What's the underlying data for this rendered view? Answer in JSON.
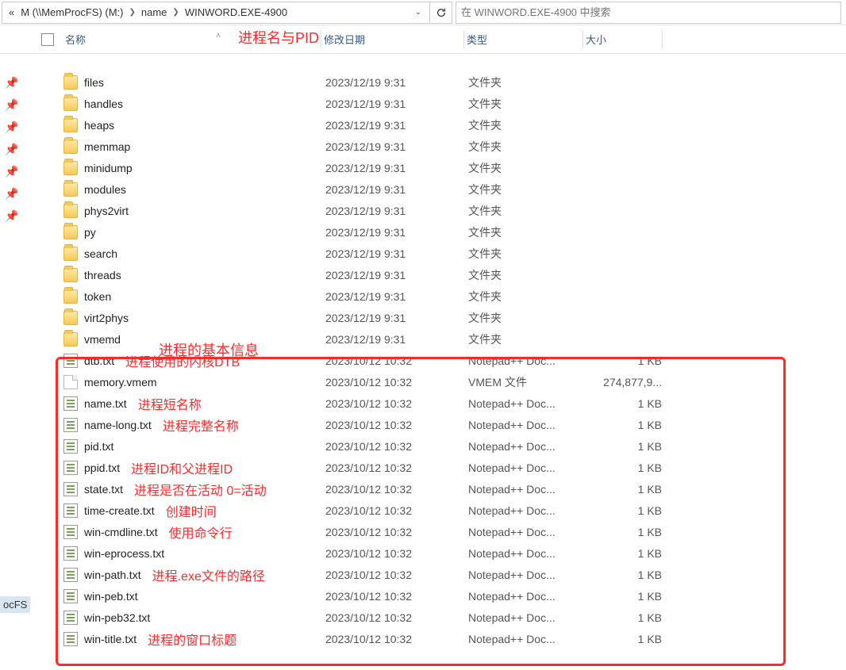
{
  "breadcrumb": {
    "prefix": "«",
    "parts": [
      "M (\\\\MemProcFS) (M:)",
      "name",
      "WINWORD.EXE-4900"
    ]
  },
  "search": {
    "placeholder": "在 WINWORD.EXE-4900 中搜索"
  },
  "columns": {
    "name": "名称",
    "date": "修改日期",
    "type": "类型",
    "size": "大小"
  },
  "annot_top": "进程名与PID",
  "annot_mid": "进程的基本信息",
  "ocfs_label": "ocFS",
  "rows": [
    {
      "icon": "folder",
      "name": "files",
      "date": "2023/12/19 9:31",
      "type": "文件夹",
      "size": ""
    },
    {
      "icon": "folder",
      "name": "handles",
      "date": "2023/12/19 9:31",
      "type": "文件夹",
      "size": ""
    },
    {
      "icon": "folder",
      "name": "heaps",
      "date": "2023/12/19 9:31",
      "type": "文件夹",
      "size": ""
    },
    {
      "icon": "folder",
      "name": "memmap",
      "date": "2023/12/19 9:31",
      "type": "文件夹",
      "size": ""
    },
    {
      "icon": "folder",
      "name": "minidump",
      "date": "2023/12/19 9:31",
      "type": "文件夹",
      "size": ""
    },
    {
      "icon": "folder",
      "name": "modules",
      "date": "2023/12/19 9:31",
      "type": "文件夹",
      "size": ""
    },
    {
      "icon": "folder",
      "name": "phys2virt",
      "date": "2023/12/19 9:31",
      "type": "文件夹",
      "size": ""
    },
    {
      "icon": "folder",
      "name": "py",
      "date": "2023/12/19 9:31",
      "type": "文件夹",
      "size": ""
    },
    {
      "icon": "folder",
      "name": "search",
      "date": "2023/12/19 9:31",
      "type": "文件夹",
      "size": ""
    },
    {
      "icon": "folder",
      "name": "threads",
      "date": "2023/12/19 9:31",
      "type": "文件夹",
      "size": ""
    },
    {
      "icon": "folder",
      "name": "token",
      "date": "2023/12/19 9:31",
      "type": "文件夹",
      "size": ""
    },
    {
      "icon": "folder",
      "name": "virt2phys",
      "date": "2023/12/19 9:31",
      "type": "文件夹",
      "size": ""
    },
    {
      "icon": "folder",
      "name": "vmemd",
      "date": "2023/12/19 9:31",
      "type": "文件夹",
      "size": ""
    },
    {
      "icon": "txt",
      "name": "dtb.txt",
      "annot": "进程使用的内核DTB",
      "date": "2023/10/12 10:32",
      "type": "Notepad++ Doc...",
      "size": "1 KB"
    },
    {
      "icon": "file",
      "name": "memory.vmem",
      "annot": "",
      "date": "2023/10/12 10:32",
      "type": "VMEM 文件",
      "size": "274,877,9..."
    },
    {
      "icon": "txt",
      "name": "name.txt",
      "annot": "进程短名称",
      "date": "2023/10/12 10:32",
      "type": "Notepad++ Doc...",
      "size": "1 KB"
    },
    {
      "icon": "txt",
      "name": "name-long.txt",
      "annot": "进程完整名称",
      "date": "2023/10/12 10:32",
      "type": "Notepad++ Doc...",
      "size": "1 KB"
    },
    {
      "icon": "txt",
      "name": "pid.txt",
      "annot": "",
      "date": "2023/10/12 10:32",
      "type": "Notepad++ Doc...",
      "size": "1 KB"
    },
    {
      "icon": "txt",
      "name": "ppid.txt",
      "annot": "进程ID和父进程ID",
      "date": "2023/10/12 10:32",
      "type": "Notepad++ Doc...",
      "size": "1 KB"
    },
    {
      "icon": "txt",
      "name": "state.txt",
      "annot": "进程是否在活动 0=活动",
      "date": "2023/10/12 10:32",
      "type": "Notepad++ Doc...",
      "size": "1 KB"
    },
    {
      "icon": "txt",
      "name": "time-create.txt",
      "annot": "创建时间",
      "date": "2023/10/12 10:32",
      "type": "Notepad++ Doc...",
      "size": "1 KB"
    },
    {
      "icon": "txt",
      "name": "win-cmdline.txt",
      "annot": "使用命令行",
      "date": "2023/10/12 10:32",
      "type": "Notepad++ Doc...",
      "size": "1 KB"
    },
    {
      "icon": "txt",
      "name": "win-eprocess.txt",
      "annot": "",
      "date": "2023/10/12 10:32",
      "type": "Notepad++ Doc...",
      "size": "1 KB"
    },
    {
      "icon": "txt",
      "name": "win-path.txt",
      "annot": "进程.exe文件的路径",
      "date": "2023/10/12 10:32",
      "type": "Notepad++ Doc...",
      "size": "1 KB"
    },
    {
      "icon": "txt",
      "name": "win-peb.txt",
      "annot": "",
      "date": "2023/10/12 10:32",
      "type": "Notepad++ Doc...",
      "size": "1 KB"
    },
    {
      "icon": "txt",
      "name": "win-peb32.txt",
      "annot": "",
      "date": "2023/10/12 10:32",
      "type": "Notepad++ Doc...",
      "size": "1 KB"
    },
    {
      "icon": "txt",
      "name": "win-title.txt",
      "annot": "进程的窗口标题",
      "date": "2023/10/12 10:32",
      "type": "Notepad++ Doc...",
      "size": "1 KB"
    }
  ]
}
